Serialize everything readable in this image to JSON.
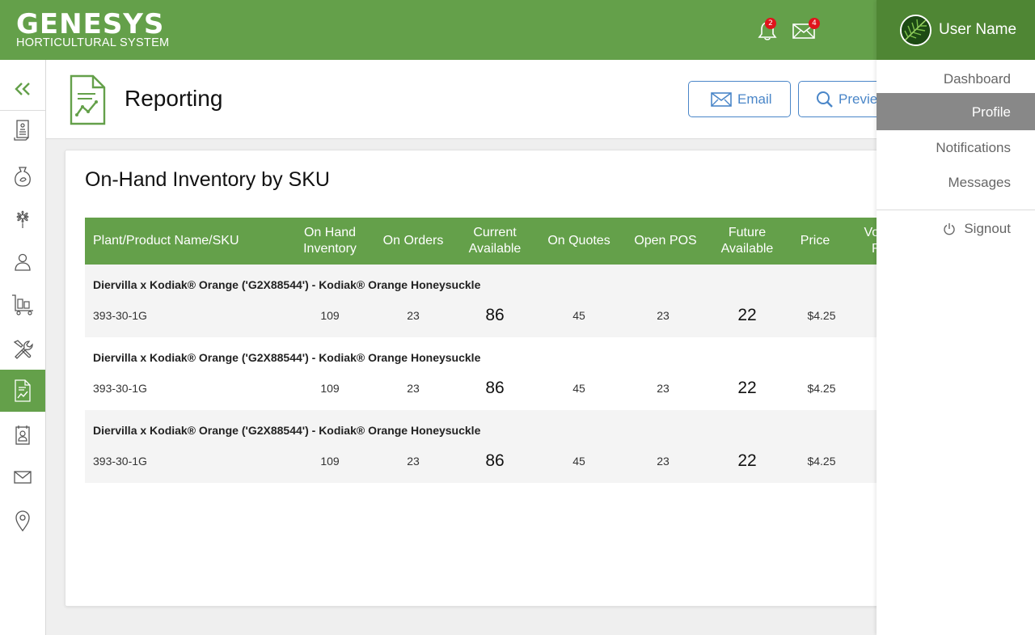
{
  "brand": {
    "name": "GENESYS",
    "tagline": "HORTICULTURAL SYSTEM"
  },
  "header": {
    "notifications": {
      "icon": "bell-icon",
      "count": "2"
    },
    "messages": {
      "icon": "envelope-icon",
      "count": "4"
    }
  },
  "user": {
    "name": "User Name",
    "menu": {
      "dashboard": "Dashboard",
      "profile": "Profile",
      "notifications": "Notifications",
      "messages": "Messages",
      "signout": "Signout"
    },
    "active_item": "Profile"
  },
  "sidebar": {
    "items": [
      {
        "name": "collapse",
        "icon": "double-chevron-left-icon"
      },
      {
        "name": "catalog",
        "icon": "document-list-icon"
      },
      {
        "name": "products",
        "icon": "seed-bag-icon"
      },
      {
        "name": "plants",
        "icon": "flower-icon"
      },
      {
        "name": "customers",
        "icon": "person-icon"
      },
      {
        "name": "shipping",
        "icon": "cart-icon"
      },
      {
        "name": "tools",
        "icon": "tools-icon"
      },
      {
        "name": "reporting",
        "icon": "report-icon",
        "active": true
      },
      {
        "name": "contacts",
        "icon": "contact-card-icon"
      },
      {
        "name": "mail",
        "icon": "mail-icon"
      },
      {
        "name": "locations",
        "icon": "map-pin-icon"
      }
    ]
  },
  "page": {
    "title": "Reporting",
    "email_label": "Email",
    "preview_label": "Preview"
  },
  "report": {
    "title": "On-Hand Inventory by SKU",
    "columns": {
      "name": "Plant/Product Name/SKU",
      "on_hand_1": "On Hand",
      "on_hand_2": "Inventory",
      "on_orders": "On Orders",
      "current_1": "Current",
      "current_2": "Available",
      "on_quotes": "On Quotes",
      "open_pos": "Open POS",
      "future_1": "Future",
      "future_2": "Available",
      "price": "Price",
      "vol_1": "Vo",
      "vol_2": "R"
    },
    "rows": [
      {
        "name": "Diervilla x Kodiak® Orange ('G2X88544') - Kodiak® Orange Honeysuckle",
        "sku": "393-30-1G",
        "on_hand": "109",
        "on_orders": "23",
        "current": "86",
        "on_quotes": "45",
        "open_pos": "23",
        "future": "22",
        "price": "$4.25"
      },
      {
        "name": "Diervilla x Kodiak® Orange ('G2X88544') - Kodiak® Orange Honeysuckle",
        "sku": "393-30-1G",
        "on_hand": "109",
        "on_orders": "23",
        "current": "86",
        "on_quotes": "45",
        "open_pos": "23",
        "future": "22",
        "price": "$4.25"
      },
      {
        "name": "Diervilla x Kodiak® Orange ('G2X88544') - Kodiak® Orange Honeysuckle",
        "sku": "393-30-1G",
        "on_hand": "109",
        "on_orders": "23",
        "current": "86",
        "on_quotes": "45",
        "open_pos": "23",
        "future": "22",
        "price": "$4.25"
      }
    ]
  },
  "colors": {
    "brand_green": "#64a04a",
    "dark_green": "#4f8634",
    "accent_blue": "#4a86c8",
    "badge_red": "#e0141c",
    "menu_active": "#888888"
  }
}
